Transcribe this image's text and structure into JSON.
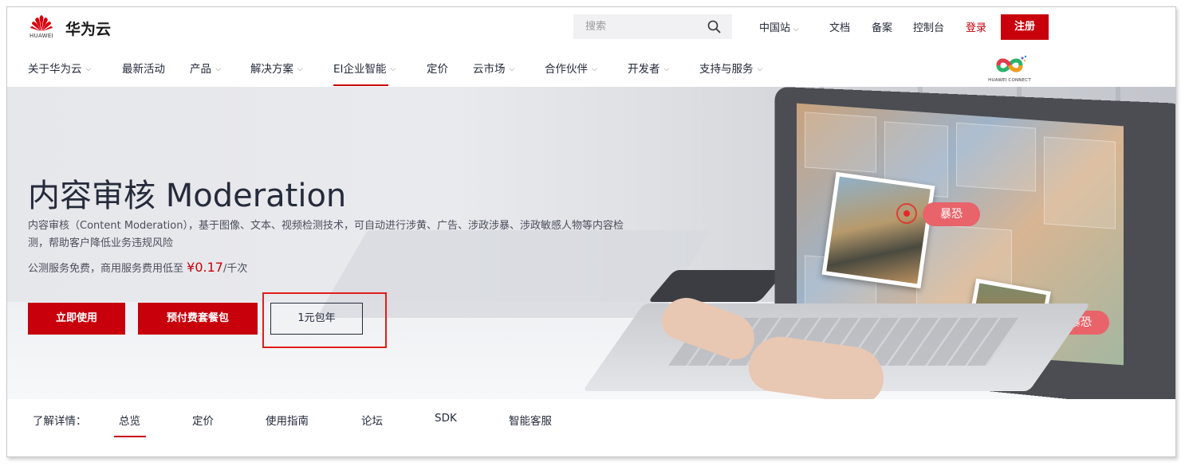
{
  "brand": {
    "logo_word": "HUAWEI",
    "name": "华为云"
  },
  "search": {
    "placeholder": "搜索"
  },
  "top_links": {
    "region": "中国站",
    "docs": "文档",
    "filing": "备案",
    "console": "控制台",
    "login": "登录",
    "register": "注册"
  },
  "nav": {
    "items": [
      {
        "label": "关于华为云",
        "has_chevron": true
      },
      {
        "label": "最新活动",
        "has_chevron": false
      },
      {
        "label": "产品",
        "has_chevron": true
      },
      {
        "label": "解决方案",
        "has_chevron": true
      },
      {
        "label": "EI企业智能",
        "has_chevron": true,
        "active": true
      },
      {
        "label": "定价",
        "has_chevron": false
      },
      {
        "label": "云市场",
        "has_chevron": true
      },
      {
        "label": "合作伙伴",
        "has_chevron": true
      },
      {
        "label": "开发者",
        "has_chevron": true
      },
      {
        "label": "支持与服务",
        "has_chevron": true
      }
    ],
    "connect_logo_text": "HUAWEI CONNECT"
  },
  "hero": {
    "title": "内容审核 Moderation",
    "description": "内容审核（Content Moderation），基于图像、文本、视频检测技术，可自动进行涉黄、广告、涉政涉暴、涉政敏感人物等内容检测，帮助客户降低业务违规风险",
    "price_prefix": "公测服务免费，商用服务费用低至 ",
    "price_amount": "¥0.17",
    "price_unit": "/千次",
    "buttons": {
      "use_now": "立即使用",
      "prepaid": "预付费套餐包",
      "yearly": "1元包年"
    },
    "tags": [
      "暴恐",
      "暴恐"
    ]
  },
  "tabs": {
    "label": "了解详情：",
    "items": [
      "总览",
      "定价",
      "使用指南",
      "论坛",
      "SDK",
      "智能客服"
    ],
    "active": "总览"
  },
  "colors": {
    "brand_red": "#c7000b",
    "tag_red": "#e8636a",
    "text_dark": "#252b3a"
  },
  "icons": [
    "huawei-logo-icon",
    "search-icon",
    "chevron-down-icon",
    "huawei-connect-logo-icon",
    "target-icon"
  ]
}
